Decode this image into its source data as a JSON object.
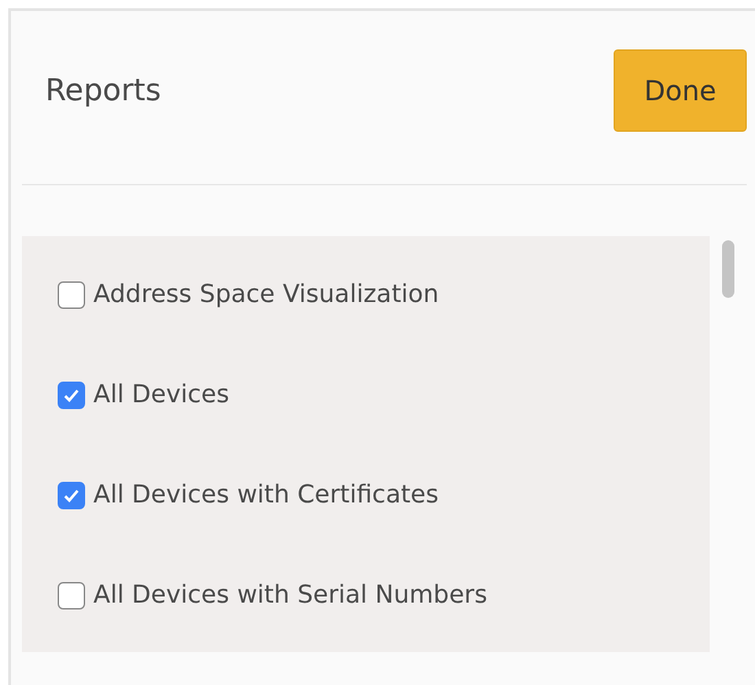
{
  "panel": {
    "title": "Reports",
    "done_button": "Done"
  },
  "reports": [
    {
      "label": "Address Space Visualization",
      "checked": false
    },
    {
      "label": "All Devices",
      "checked": true
    },
    {
      "label": "All Devices with Certificates",
      "checked": true
    },
    {
      "label": "All Devices with Serial Numbers",
      "checked": false
    }
  ]
}
